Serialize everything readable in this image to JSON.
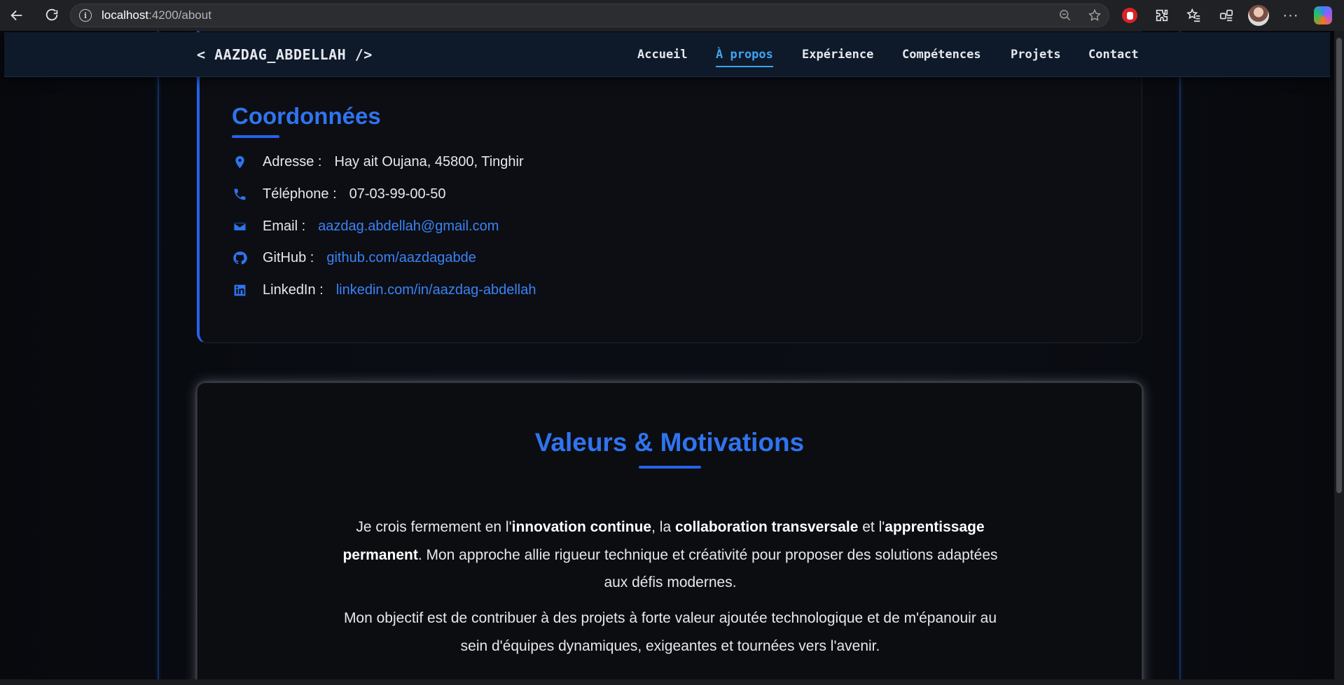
{
  "browser": {
    "url_host": "localhost",
    "url_path": ":4200/about"
  },
  "header": {
    "brand": "< AAZDAG_ABDELLAH />",
    "nav": [
      {
        "label": "Accueil",
        "active": false
      },
      {
        "label": "À propos",
        "active": true
      },
      {
        "label": "Expérience",
        "active": false
      },
      {
        "label": "Compétences",
        "active": false
      },
      {
        "label": "Projets",
        "active": false
      },
      {
        "label": "Contact",
        "active": false
      }
    ]
  },
  "contact": {
    "title": "Coordonnées",
    "items": [
      {
        "icon": "map-pin-icon",
        "label": "Adresse :",
        "value": "Hay ait Oujana, 45800, Tinghir",
        "is_link": false
      },
      {
        "icon": "phone-icon",
        "label": "Téléphone :",
        "value": "07-03-99-00-50",
        "is_link": false
      },
      {
        "icon": "envelope-icon",
        "label": "Email :",
        "value": "aazdag.abdellah@gmail.com",
        "is_link": true
      },
      {
        "icon": "github-icon",
        "label": "GitHub :",
        "value": "github.com/aazdagabde",
        "is_link": true
      },
      {
        "icon": "linkedin-icon",
        "label": "LinkedIn :",
        "value": "linkedin.com/in/aazdag-abdellah",
        "is_link": true
      }
    ]
  },
  "values": {
    "title": "Valeurs & Motivations",
    "p1": {
      "t1": "Je crois fermement en l'",
      "b1": "innovation continue",
      "t2": ", la ",
      "b2": "collaboration transversale",
      "t3": " et l'",
      "b3": "apprentissage permanent",
      "t4": ". Mon approche allie rigueur technique et créativité pour proposer des solutions adaptées aux défis modernes."
    },
    "p2": "Mon objectif est de contribuer à des projets à forte valeur ajoutée technologique et de m'épanouir au sein d'équipes dynamiques, exigeantes et tournées vers l'avenir."
  },
  "colors": {
    "accent": "#2f74f0",
    "nav_active": "#3fa3f0",
    "header_bg": "#0e1a2a",
    "page_bg": "#0a0b0f"
  }
}
